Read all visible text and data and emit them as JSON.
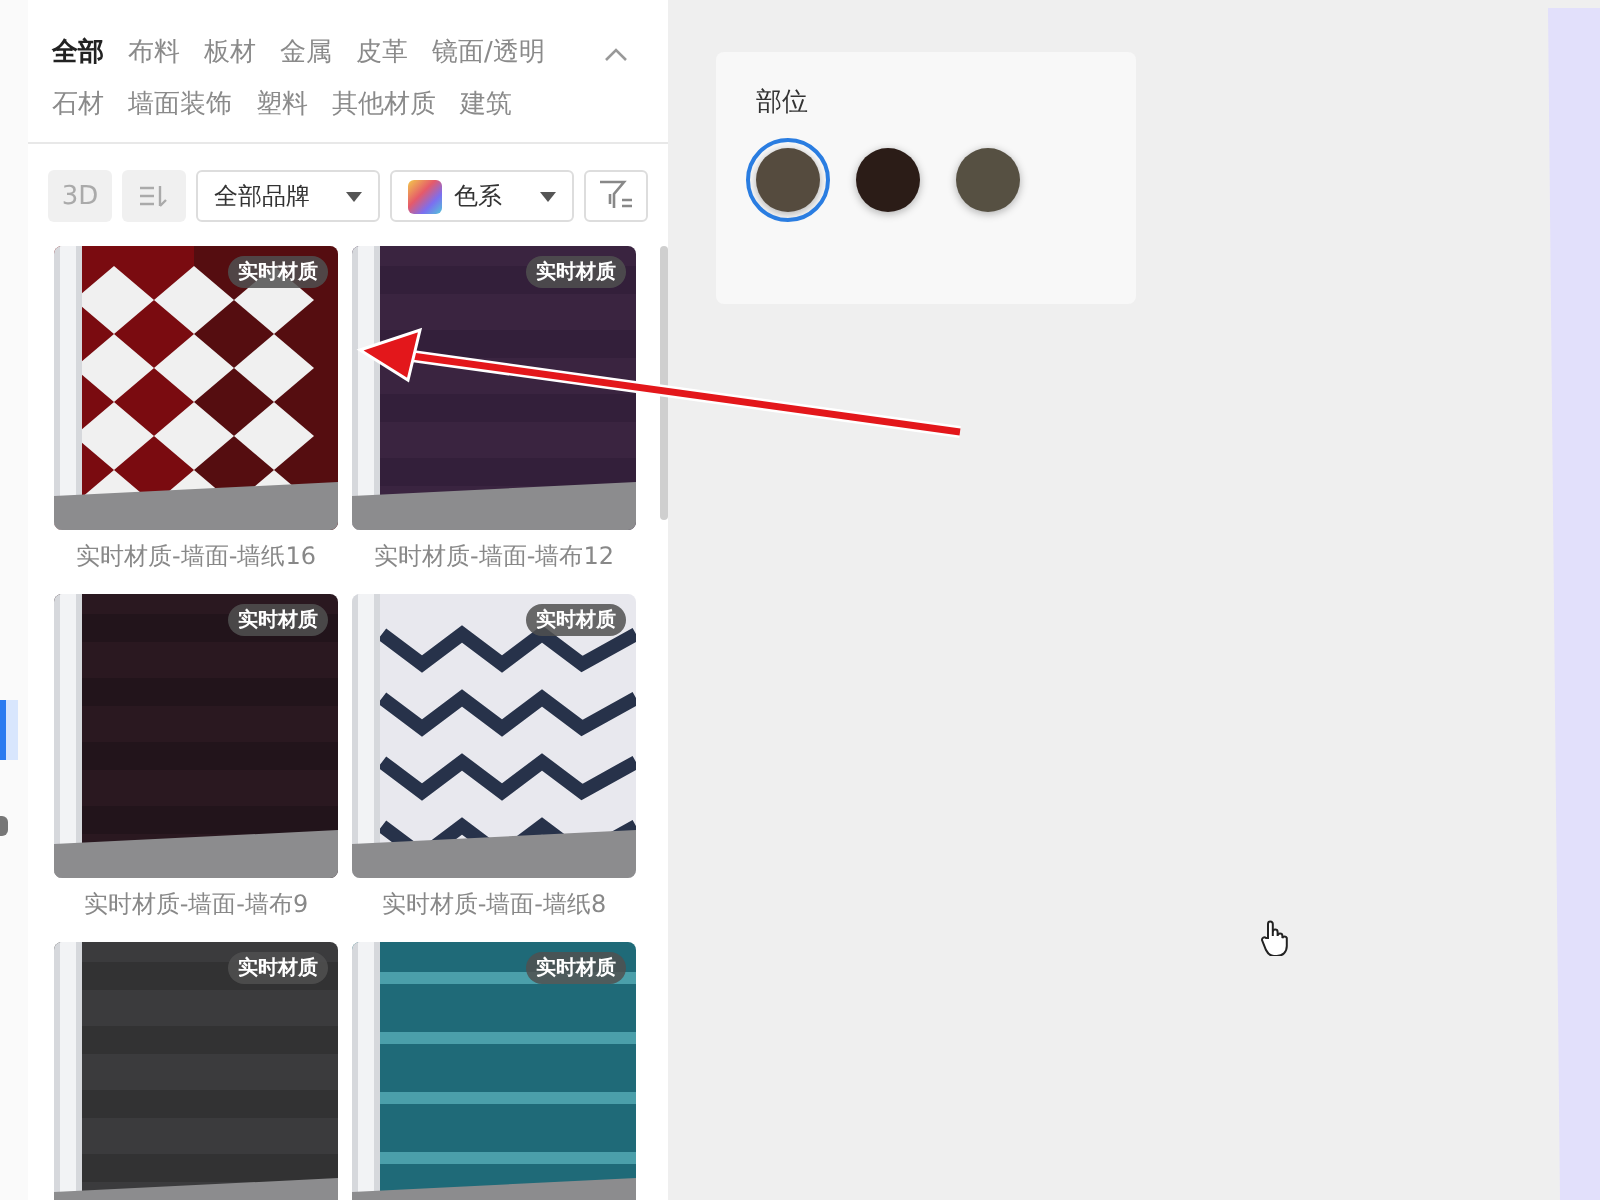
{
  "categories": [
    {
      "label": "全部",
      "selected": true
    },
    {
      "label": "布料",
      "selected": false
    },
    {
      "label": "板材",
      "selected": false
    },
    {
      "label": "金属",
      "selected": false
    },
    {
      "label": "皮革",
      "selected": false
    },
    {
      "label": "镜面/透明",
      "selected": false
    },
    {
      "label": "石材",
      "selected": false
    },
    {
      "label": "墙面装饰",
      "selected": false
    },
    {
      "label": "塑料",
      "selected": false
    },
    {
      "label": "其他材质",
      "selected": false
    },
    {
      "label": "建筑",
      "selected": false
    }
  ],
  "toolbar": {
    "mode_button": "3D",
    "brand_dropdown": "全部品牌",
    "color_dropdown": "色系"
  },
  "materials": [
    {
      "badge": "实时材质",
      "label": "实时材质-墙面-墙纸16"
    },
    {
      "badge": "实时材质",
      "label": "实时材质-墙面-墙布12"
    },
    {
      "badge": "实时材质",
      "label": "实时材质-墙面-墙布9"
    },
    {
      "badge": "实时材质",
      "label": "实时材质-墙面-墙纸8"
    },
    {
      "badge": "实时材质"
    },
    {
      "badge": "实时材质"
    }
  ],
  "part_card": {
    "title": "部位",
    "swatches": [
      {
        "color": "#554b3e",
        "selected": true
      },
      {
        "color": "#2b1c17",
        "selected": false
      },
      {
        "color": "#565042",
        "selected": false
      }
    ]
  }
}
